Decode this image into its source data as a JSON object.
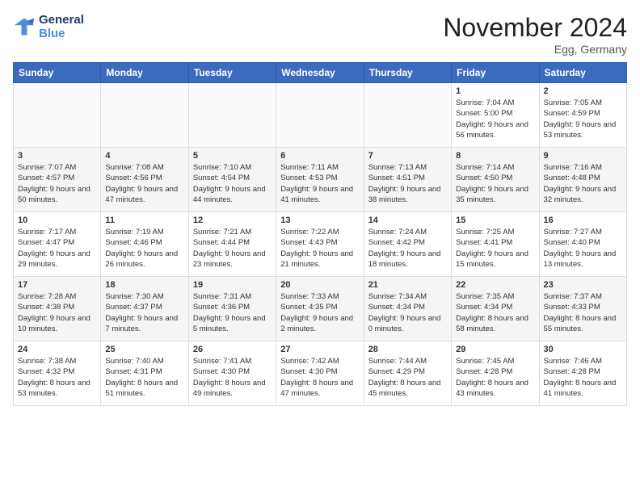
{
  "logo": {
    "line1": "General",
    "line2": "Blue"
  },
  "title": "November 2024",
  "location": "Egg, Germany",
  "days_header": [
    "Sunday",
    "Monday",
    "Tuesday",
    "Wednesday",
    "Thursday",
    "Friday",
    "Saturday"
  ],
  "weeks": [
    [
      {
        "day": "",
        "info": ""
      },
      {
        "day": "",
        "info": ""
      },
      {
        "day": "",
        "info": ""
      },
      {
        "day": "",
        "info": ""
      },
      {
        "day": "",
        "info": ""
      },
      {
        "day": "1",
        "info": "Sunrise: 7:04 AM\nSunset: 5:00 PM\nDaylight: 9 hours and 56 minutes."
      },
      {
        "day": "2",
        "info": "Sunrise: 7:05 AM\nSunset: 4:59 PM\nDaylight: 9 hours and 53 minutes."
      }
    ],
    [
      {
        "day": "3",
        "info": "Sunrise: 7:07 AM\nSunset: 4:57 PM\nDaylight: 9 hours and 50 minutes."
      },
      {
        "day": "4",
        "info": "Sunrise: 7:08 AM\nSunset: 4:56 PM\nDaylight: 9 hours and 47 minutes."
      },
      {
        "day": "5",
        "info": "Sunrise: 7:10 AM\nSunset: 4:54 PM\nDaylight: 9 hours and 44 minutes."
      },
      {
        "day": "6",
        "info": "Sunrise: 7:11 AM\nSunset: 4:53 PM\nDaylight: 9 hours and 41 minutes."
      },
      {
        "day": "7",
        "info": "Sunrise: 7:13 AM\nSunset: 4:51 PM\nDaylight: 9 hours and 38 minutes."
      },
      {
        "day": "8",
        "info": "Sunrise: 7:14 AM\nSunset: 4:50 PM\nDaylight: 9 hours and 35 minutes."
      },
      {
        "day": "9",
        "info": "Sunrise: 7:16 AM\nSunset: 4:48 PM\nDaylight: 9 hours and 32 minutes."
      }
    ],
    [
      {
        "day": "10",
        "info": "Sunrise: 7:17 AM\nSunset: 4:47 PM\nDaylight: 9 hours and 29 minutes."
      },
      {
        "day": "11",
        "info": "Sunrise: 7:19 AM\nSunset: 4:46 PM\nDaylight: 9 hours and 26 minutes."
      },
      {
        "day": "12",
        "info": "Sunrise: 7:21 AM\nSunset: 4:44 PM\nDaylight: 9 hours and 23 minutes."
      },
      {
        "day": "13",
        "info": "Sunrise: 7:22 AM\nSunset: 4:43 PM\nDaylight: 9 hours and 21 minutes."
      },
      {
        "day": "14",
        "info": "Sunrise: 7:24 AM\nSunset: 4:42 PM\nDaylight: 9 hours and 18 minutes."
      },
      {
        "day": "15",
        "info": "Sunrise: 7:25 AM\nSunset: 4:41 PM\nDaylight: 9 hours and 15 minutes."
      },
      {
        "day": "16",
        "info": "Sunrise: 7:27 AM\nSunset: 4:40 PM\nDaylight: 9 hours and 13 minutes."
      }
    ],
    [
      {
        "day": "17",
        "info": "Sunrise: 7:28 AM\nSunset: 4:38 PM\nDaylight: 9 hours and 10 minutes."
      },
      {
        "day": "18",
        "info": "Sunrise: 7:30 AM\nSunset: 4:37 PM\nDaylight: 9 hours and 7 minutes."
      },
      {
        "day": "19",
        "info": "Sunrise: 7:31 AM\nSunset: 4:36 PM\nDaylight: 9 hours and 5 minutes."
      },
      {
        "day": "20",
        "info": "Sunrise: 7:33 AM\nSunset: 4:35 PM\nDaylight: 9 hours and 2 minutes."
      },
      {
        "day": "21",
        "info": "Sunrise: 7:34 AM\nSunset: 4:34 PM\nDaylight: 9 hours and 0 minutes."
      },
      {
        "day": "22",
        "info": "Sunrise: 7:35 AM\nSunset: 4:34 PM\nDaylight: 8 hours and 58 minutes."
      },
      {
        "day": "23",
        "info": "Sunrise: 7:37 AM\nSunset: 4:33 PM\nDaylight: 8 hours and 55 minutes."
      }
    ],
    [
      {
        "day": "24",
        "info": "Sunrise: 7:38 AM\nSunset: 4:32 PM\nDaylight: 8 hours and 53 minutes."
      },
      {
        "day": "25",
        "info": "Sunrise: 7:40 AM\nSunset: 4:31 PM\nDaylight: 8 hours and 51 minutes."
      },
      {
        "day": "26",
        "info": "Sunrise: 7:41 AM\nSunset: 4:30 PM\nDaylight: 8 hours and 49 minutes."
      },
      {
        "day": "27",
        "info": "Sunrise: 7:42 AM\nSunset: 4:30 PM\nDaylight: 8 hours and 47 minutes."
      },
      {
        "day": "28",
        "info": "Sunrise: 7:44 AM\nSunset: 4:29 PM\nDaylight: 8 hours and 45 minutes."
      },
      {
        "day": "29",
        "info": "Sunrise: 7:45 AM\nSunset: 4:28 PM\nDaylight: 8 hours and 43 minutes."
      },
      {
        "day": "30",
        "info": "Sunrise: 7:46 AM\nSunset: 4:28 PM\nDaylight: 8 hours and 41 minutes."
      }
    ]
  ]
}
